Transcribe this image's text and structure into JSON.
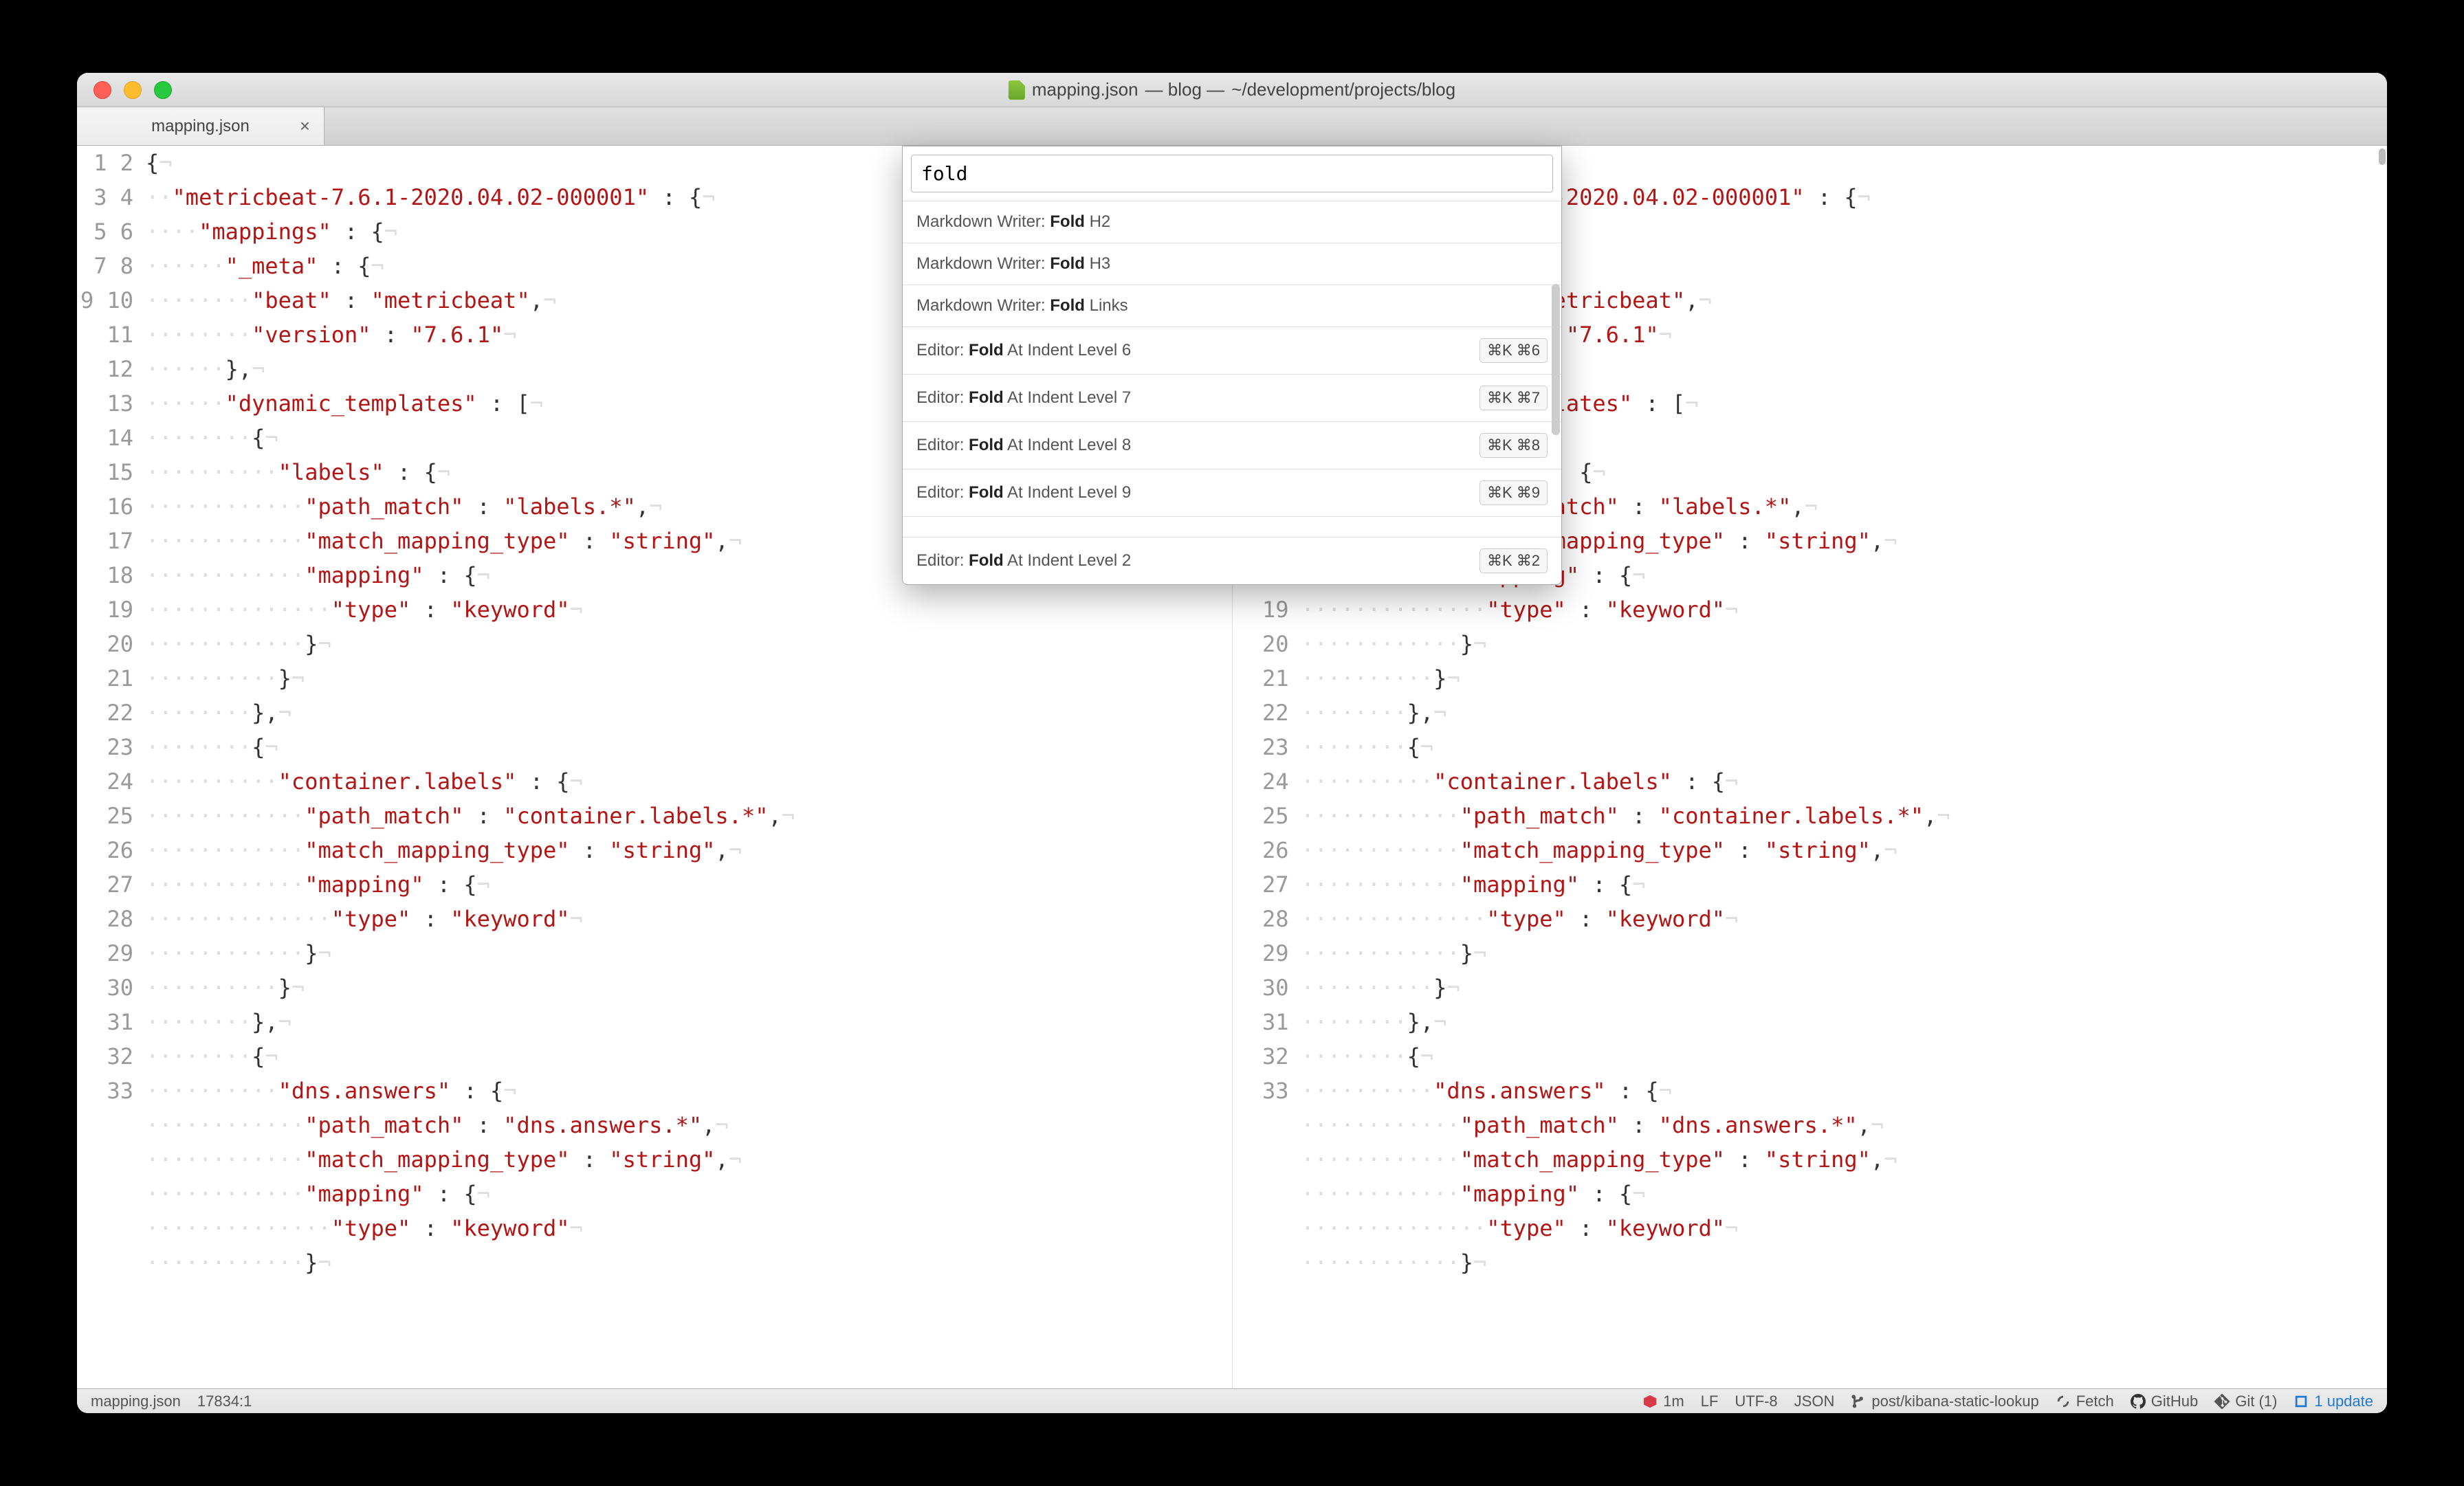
{
  "window": {
    "title_file": "mapping.json",
    "title_project": "— blog —",
    "title_path": "~/development/projects/blog"
  },
  "tabs": [
    {
      "label": "mapping.json"
    }
  ],
  "palette": {
    "query": "fold",
    "items": [
      {
        "prefix": "Markdown Writer: ",
        "bold": "Fold",
        "suffix": " H2",
        "kbd": ""
      },
      {
        "prefix": "Markdown Writer: ",
        "bold": "Fold",
        "suffix": " H3",
        "kbd": ""
      },
      {
        "prefix": "Markdown Writer: ",
        "bold": "Fold",
        "suffix": " Links",
        "kbd": ""
      },
      {
        "prefix": "Editor: ",
        "bold": "Fold",
        "suffix": " At Indent Level 6",
        "kbd": "⌘K ⌘6"
      },
      {
        "prefix": "Editor: ",
        "bold": "Fold",
        "suffix": " At Indent Level 7",
        "kbd": "⌘K ⌘7"
      },
      {
        "prefix": "Editor: ",
        "bold": "Fold",
        "suffix": " At Indent Level 8",
        "kbd": "⌘K ⌘8"
      },
      {
        "prefix": "Editor: ",
        "bold": "Fold",
        "suffix": " At Indent Level 9",
        "kbd": "⌘K ⌘9"
      },
      {
        "separator": true
      },
      {
        "prefix": "Editor: ",
        "bold": "Fold",
        "suffix": " At Indent Level 2",
        "kbd": "⌘K ⌘2"
      }
    ]
  },
  "code": {
    "lines": [
      [
        [
          "p",
          "{"
        ],
        [
          "i",
          "¬"
        ]
      ],
      [
        [
          "d",
          "··"
        ],
        [
          "s",
          "\"metricbeat-7.6.1-2020.04.02-000001\""
        ],
        [
          "p",
          " : {"
        ],
        [
          "i",
          "¬"
        ]
      ],
      [
        [
          "d",
          "····"
        ],
        [
          "s",
          "\"mappings\""
        ],
        [
          "p",
          " : {"
        ],
        [
          "i",
          "¬"
        ]
      ],
      [
        [
          "d",
          "······"
        ],
        [
          "s",
          "\"_meta\""
        ],
        [
          "p",
          " : {"
        ],
        [
          "i",
          "¬"
        ]
      ],
      [
        [
          "d",
          "········"
        ],
        [
          "s",
          "\"beat\""
        ],
        [
          "p",
          " : "
        ],
        [
          "s",
          "\"metricbeat\""
        ],
        [
          "p",
          ","
        ],
        [
          "i",
          "¬"
        ]
      ],
      [
        [
          "d",
          "········"
        ],
        [
          "s",
          "\"version\""
        ],
        [
          "p",
          " : "
        ],
        [
          "s",
          "\"7.6.1\""
        ],
        [
          "i",
          "¬"
        ]
      ],
      [
        [
          "d",
          "······"
        ],
        [
          "p",
          "},"
        ],
        [
          "i",
          "¬"
        ]
      ],
      [
        [
          "d",
          "······"
        ],
        [
          "s",
          "\"dynamic_templates\""
        ],
        [
          "p",
          " : ["
        ],
        [
          "i",
          "¬"
        ]
      ],
      [
        [
          "d",
          "········"
        ],
        [
          "p",
          "{"
        ],
        [
          "i",
          "¬"
        ]
      ],
      [
        [
          "d",
          "··········"
        ],
        [
          "s",
          "\"labels\""
        ],
        [
          "p",
          " : {"
        ],
        [
          "i",
          "¬"
        ]
      ],
      [
        [
          "d",
          "············"
        ],
        [
          "s",
          "\"path_match\""
        ],
        [
          "p",
          " : "
        ],
        [
          "s",
          "\"labels.*\""
        ],
        [
          "p",
          ","
        ],
        [
          "i",
          "¬"
        ]
      ],
      [
        [
          "d",
          "············"
        ],
        [
          "s",
          "\"match_mapping_type\""
        ],
        [
          "p",
          " : "
        ],
        [
          "s",
          "\"string\""
        ],
        [
          "p",
          ","
        ],
        [
          "i",
          "¬"
        ]
      ],
      [
        [
          "d",
          "············"
        ],
        [
          "s",
          "\"mapping\""
        ],
        [
          "p",
          " : {"
        ],
        [
          "i",
          "¬"
        ]
      ],
      [
        [
          "d",
          "··············"
        ],
        [
          "s",
          "\"type\""
        ],
        [
          "p",
          " : "
        ],
        [
          "s",
          "\"keyword\""
        ],
        [
          "i",
          "¬"
        ]
      ],
      [
        [
          "d",
          "············"
        ],
        [
          "p",
          "}"
        ],
        [
          "i",
          "¬"
        ]
      ],
      [
        [
          "d",
          "··········"
        ],
        [
          "p",
          "}"
        ],
        [
          "i",
          "¬"
        ]
      ],
      [
        [
          "d",
          "········"
        ],
        [
          "p",
          "},"
        ],
        [
          "i",
          "¬"
        ]
      ],
      [
        [
          "d",
          "········"
        ],
        [
          "p",
          "{"
        ],
        [
          "i",
          "¬"
        ]
      ],
      [
        [
          "d",
          "··········"
        ],
        [
          "s",
          "\"container.labels\""
        ],
        [
          "p",
          " : {"
        ],
        [
          "i",
          "¬"
        ]
      ],
      [
        [
          "d",
          "············"
        ],
        [
          "s",
          "\"path_match\""
        ],
        [
          "p",
          " : "
        ],
        [
          "s",
          "\"container.labels.*\""
        ],
        [
          "p",
          ","
        ],
        [
          "i",
          "¬"
        ]
      ],
      [
        [
          "d",
          "············"
        ],
        [
          "s",
          "\"match_mapping_type\""
        ],
        [
          "p",
          " : "
        ],
        [
          "s",
          "\"string\""
        ],
        [
          "p",
          ","
        ],
        [
          "i",
          "¬"
        ]
      ],
      [
        [
          "d",
          "············"
        ],
        [
          "s",
          "\"mapping\""
        ],
        [
          "p",
          " : {"
        ],
        [
          "i",
          "¬"
        ]
      ],
      [
        [
          "d",
          "··············"
        ],
        [
          "s",
          "\"type\""
        ],
        [
          "p",
          " : "
        ],
        [
          "s",
          "\"keyword\""
        ],
        [
          "i",
          "¬"
        ]
      ],
      [
        [
          "d",
          "············"
        ],
        [
          "p",
          "}"
        ],
        [
          "i",
          "¬"
        ]
      ],
      [
        [
          "d",
          "··········"
        ],
        [
          "p",
          "}"
        ],
        [
          "i",
          "¬"
        ]
      ],
      [
        [
          "d",
          "········"
        ],
        [
          "p",
          "},"
        ],
        [
          "i",
          "¬"
        ]
      ],
      [
        [
          "d",
          "········"
        ],
        [
          "p",
          "{"
        ],
        [
          "i",
          "¬"
        ]
      ],
      [
        [
          "d",
          "··········"
        ],
        [
          "s",
          "\"dns.answers\""
        ],
        [
          "p",
          " : {"
        ],
        [
          "i",
          "¬"
        ]
      ],
      [
        [
          "d",
          "············"
        ],
        [
          "s",
          "\"path_match\""
        ],
        [
          "p",
          " : "
        ],
        [
          "s",
          "\"dns.answers.*\""
        ],
        [
          "p",
          ","
        ],
        [
          "i",
          "¬"
        ]
      ],
      [
        [
          "d",
          "············"
        ],
        [
          "s",
          "\"match_mapping_type\""
        ],
        [
          "p",
          " : "
        ],
        [
          "s",
          "\"string\""
        ],
        [
          "p",
          ","
        ],
        [
          "i",
          "¬"
        ]
      ],
      [
        [
          "d",
          "············"
        ],
        [
          "s",
          "\"mapping\""
        ],
        [
          "p",
          " : {"
        ],
        [
          "i",
          "¬"
        ]
      ],
      [
        [
          "d",
          "··············"
        ],
        [
          "s",
          "\"type\""
        ],
        [
          "p",
          " : "
        ],
        [
          "s",
          "\"keyword\""
        ],
        [
          "i",
          "¬"
        ]
      ],
      [
        [
          "d",
          "············"
        ],
        [
          "p",
          "}"
        ],
        [
          "i",
          "¬"
        ]
      ]
    ]
  },
  "status": {
    "file": "mapping.json",
    "cursor": "17834:1",
    "diag_time": "1m",
    "eol": "LF",
    "encoding": "UTF-8",
    "lang": "JSON",
    "branch": "post/kibana-static-lookup",
    "fetch": "Fetch",
    "github": "GitHub",
    "git": "Git (1)",
    "update": "1 update"
  }
}
